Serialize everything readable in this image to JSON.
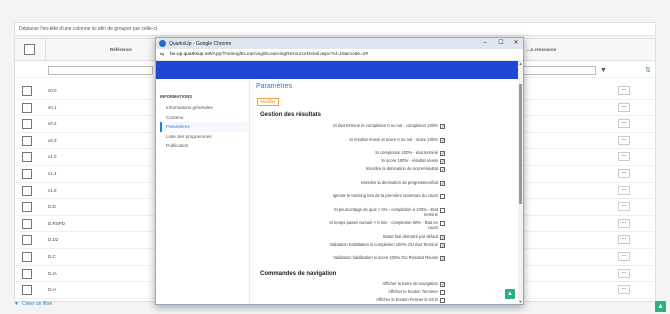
{
  "background": {
    "group_hint": "Déplacer l'en-tête d'une colonne ici afin de grouper par celle-ci",
    "columns": {
      "reference": "Référence",
      "resource": "...n ressource"
    },
    "rows": [
      {
        "ref": "v0.0",
        "action": "..."
      },
      {
        "ref": "v0.1",
        "action": "..."
      },
      {
        "ref": "v0.2",
        "action": "..."
      },
      {
        "ref": "v0.3",
        "action": "..."
      },
      {
        "ref": "v1.0",
        "action": "..."
      },
      {
        "ref": "v1.4",
        "action": "..."
      },
      {
        "ref": "v1.9",
        "action": "..."
      },
      {
        "ref": "D.D",
        "action": "..."
      },
      {
        "ref": "D.RSPD",
        "action": "..."
      },
      {
        "ref": "D.D2",
        "action": "..."
      },
      {
        "ref": "D.C",
        "action": "..."
      },
      {
        "ref": "D.IA",
        "action": "..."
      },
      {
        "ref": "D.H",
        "action": "..."
      }
    ],
    "create_filter": "Créer un filtre",
    "accent": "#2c7fb8"
  },
  "window": {
    "title": "QuarksUp - Google Chrome",
    "url_host": "be-up.quarksup.net",
    "url_path": "/App/Training/ELearning/ELearningResourceDetail.aspx?id=16&mode=0#",
    "controls": {
      "minimize": "–",
      "maximize": "☐",
      "close": "✕"
    }
  },
  "sidenav": {
    "title": "INFORMATIONS",
    "items": [
      {
        "label": "Informations générales",
        "active": false
      },
      {
        "label": "Contenu",
        "active": false
      },
      {
        "label": "Paramètres",
        "active": true
      },
      {
        "label": "Liste des programmes",
        "active": false
      },
      {
        "label": "Publication",
        "active": false
      }
    ]
  },
  "panel": {
    "title": "Paramètres",
    "modify_label": "Modifier",
    "results_title": "Gestion des résultats",
    "results_options": [
      {
        "label": "Si état terminé et completion 0 ou nul - completion 100%",
        "checked": true
      },
      {
        "label": "Si résultat réussi et score 0 ou nul - score 100%",
        "checked": true
      },
      {
        "label": "Si completion 100% - état terminé",
        "checked": true
      },
      {
        "label": "Si score 100% - résultat réussi",
        "checked": true
      },
      {
        "label": "Interdire la diminution de score/résultat",
        "checked": true
      },
      {
        "label": "Interdire la diminution de progression/état",
        "checked": true
      },
      {
        "label": "Ignorer le tracking lors de la première ouverture du cours",
        "checked": false
      },
      {
        "label": "Si pourcentage de quiz > 0% - completion à 100% - État terminé",
        "checked": false
      },
      {
        "label": "Si temps passé cumulé > 0 min - completion 50% - État en cours",
        "checked": false
      },
      {
        "label": "Statut fixé démarré par défaut",
        "checked": true
      },
      {
        "label": "Validation habilitation si completion 100% OU état Terminé",
        "checked": true
      },
      {
        "label": "Validation habilitation si score 100% OU Résultat Réussi",
        "checked": true
      }
    ],
    "nav_title": "Commandes de navigation",
    "nav_options": [
      {
        "label": "Afficher la barre de navigation",
        "checked": true
      },
      {
        "label": "Afficher le bouton Terminer",
        "checked": false
      },
      {
        "label": "Afficher le bouton Fermer le SCO",
        "checked": false
      },
      {
        "label": "Afficher la barre de progression",
        "checked": true
      }
    ],
    "accent": "#2a7ae2",
    "header_color": "#1f46d6"
  }
}
